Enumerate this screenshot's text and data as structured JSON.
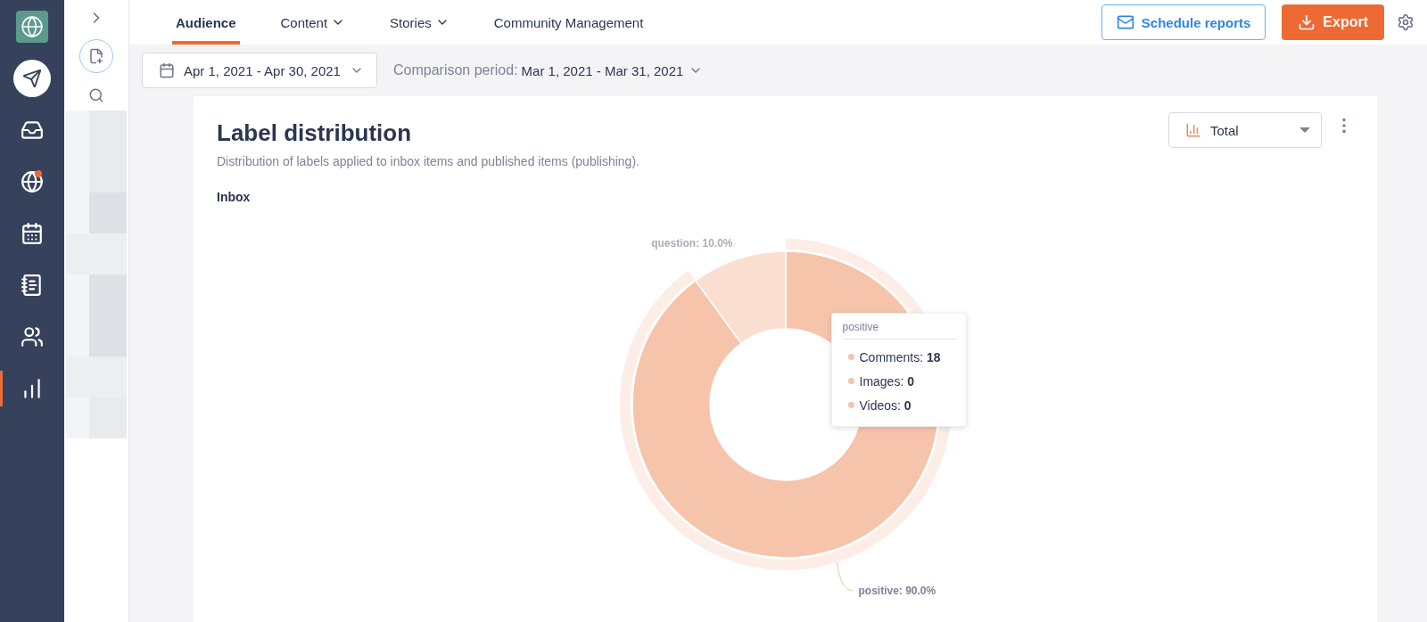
{
  "nav_items": [
    {
      "kind": "compose",
      "selected": false,
      "notification": false
    },
    {
      "kind": "inbox",
      "selected": false,
      "notification": false
    },
    {
      "kind": "listening",
      "selected": false,
      "notification": true
    },
    {
      "kind": "calendar",
      "selected": false,
      "notification": false
    },
    {
      "kind": "planner",
      "selected": false,
      "notification": false
    },
    {
      "kind": "people",
      "selected": false,
      "notification": false
    },
    {
      "kind": "reports",
      "selected": true,
      "notification": false
    }
  ],
  "tabs": [
    {
      "label": "Audience",
      "selected": true,
      "has_menu": false
    },
    {
      "label": "Content",
      "selected": false,
      "has_menu": true
    },
    {
      "label": "Stories",
      "selected": false,
      "has_menu": true
    },
    {
      "label": "Community Management",
      "selected": false,
      "has_menu": false
    }
  ],
  "actions": {
    "schedule": "Schedule reports",
    "export": "Export"
  },
  "toolbar": {
    "date_range": "Apr 1, 2021 - Apr 30, 2021",
    "comparison_label": "Comparison period:",
    "comparison_range": "Mar 1, 2021 - Mar 31, 2021"
  },
  "card": {
    "title": "Label distribution",
    "description": "Distribution of labels applied to inbox items and published items (publishing).",
    "view_select": "Total",
    "chart_data": {
      "type": "donut",
      "categories": [
        "positive",
        "question"
      ],
      "series": [
        {
          "name": "Inbox",
          "values": [
            90,
            10
          ]
        }
      ],
      "value_labels": [
        "90.0%",
        "10.0%"
      ]
    },
    "label_separator": ": ",
    "tooltip": {
      "title": "positive",
      "rows": [
        {
          "label": "Comments:",
          "value": "18"
        },
        {
          "label": "Images:",
          "value": "0"
        },
        {
          "label": "Videos:",
          "value": "0"
        }
      ]
    }
  }
}
